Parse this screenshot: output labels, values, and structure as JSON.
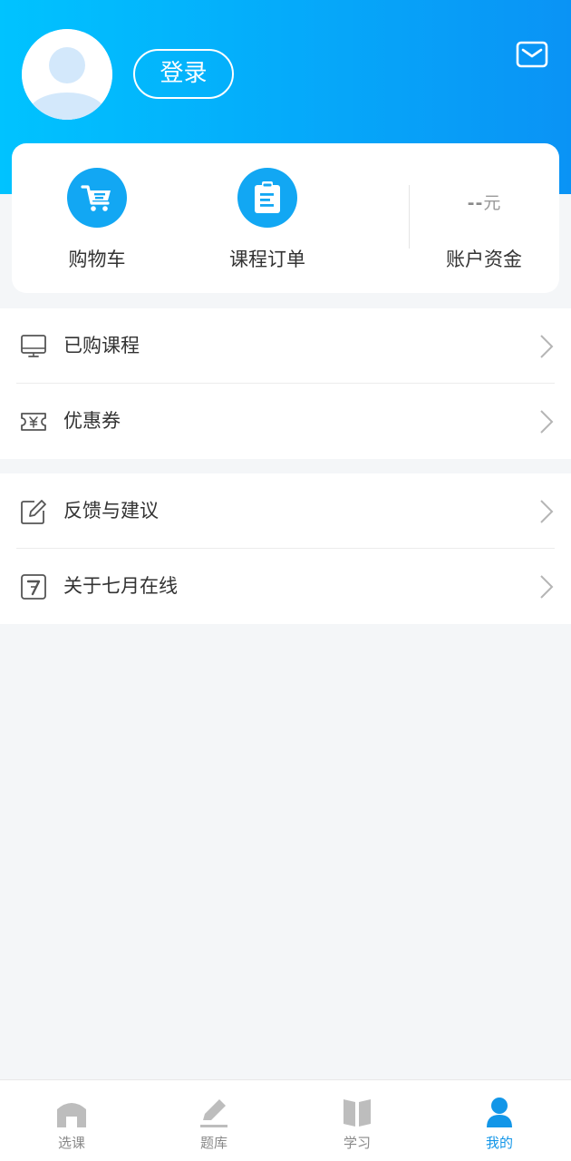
{
  "header": {
    "login_label": "登录",
    "accent_gradient": [
      "#00c3ff",
      "#0a93f5"
    ]
  },
  "quick_actions": {
    "cart_label": "购物车",
    "orders_label": "课程订单",
    "funds_label": "账户资金",
    "funds_value": "--",
    "funds_unit": "元"
  },
  "menu_group_1": {
    "items": [
      {
        "label": "已购课程",
        "icon": "monitor-icon"
      },
      {
        "label": "优惠券",
        "icon": "coupon-icon"
      }
    ]
  },
  "menu_group_2": {
    "items": [
      {
        "label": "反馈与建议",
        "icon": "edit-icon"
      },
      {
        "label": "关于七月在线",
        "icon": "seven-logo-icon"
      }
    ]
  },
  "tabbar": {
    "tabs": [
      {
        "label": "选课",
        "icon": "home-icon",
        "active": false
      },
      {
        "label": "题库",
        "icon": "pencil-icon",
        "active": false
      },
      {
        "label": "学习",
        "icon": "book-icon",
        "active": false
      },
      {
        "label": "我的",
        "icon": "user-icon",
        "active": true
      }
    ],
    "active_color": "#1296e8",
    "inactive_color": "#888888"
  }
}
